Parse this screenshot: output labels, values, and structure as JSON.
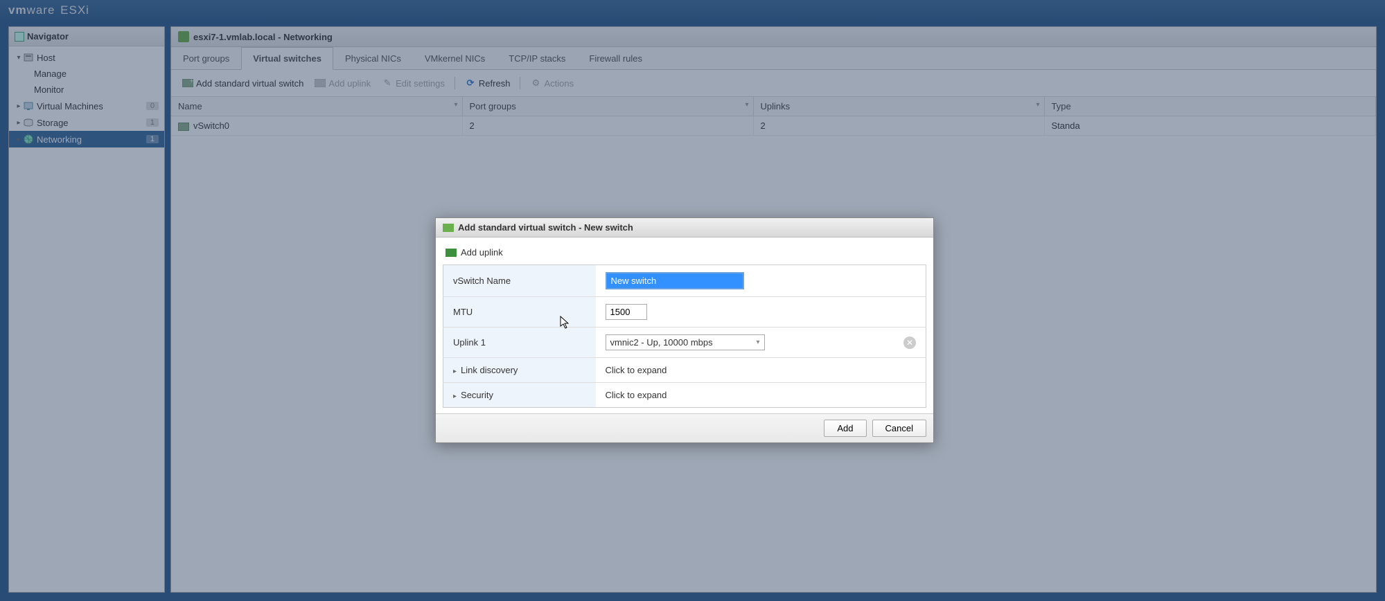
{
  "header": {
    "brand_vm": "vm",
    "brand_ware": "ware",
    "brand_esxi": " ESXi"
  },
  "sidebar": {
    "title": "Navigator",
    "header_badge": "",
    "host": {
      "label": "Host",
      "manage": "Manage",
      "monitor": "Monitor"
    },
    "vms": {
      "label": "Virtual Machines",
      "count": "0"
    },
    "storage": {
      "label": "Storage",
      "count": "1"
    },
    "networking": {
      "label": "Networking",
      "count": "1"
    }
  },
  "content": {
    "breadcrumb": "esxi7-1.vmlab.local - Networking",
    "tabs": {
      "port_groups": "Port groups",
      "virtual_switches": "Virtual switches",
      "physical_nics": "Physical NICs",
      "vmkernel_nics": "VMkernel NICs",
      "tcpip_stacks": "TCP/IP stacks",
      "firewall_rules": "Firewall rules"
    },
    "toolbar": {
      "add_switch": "Add standard virtual switch",
      "add_uplink": "Add uplink",
      "edit_settings": "Edit settings",
      "refresh": "Refresh",
      "actions": "Actions"
    },
    "grid": {
      "cols": {
        "name": "Name",
        "port_groups": "Port groups",
        "uplinks": "Uplinks",
        "type": "Type"
      },
      "rows": [
        {
          "name": "vSwitch0",
          "port_groups": "2",
          "uplinks": "2",
          "type": "Standa"
        }
      ]
    }
  },
  "dialog": {
    "title": "Add standard virtual switch - New switch",
    "add_uplink": "Add uplink",
    "rows": {
      "name_label": "vSwitch Name",
      "name_value": "New switch",
      "mtu_label": "MTU",
      "mtu_value": "1500",
      "uplink1_label": "Uplink 1",
      "uplink1_value": "vmnic2 - Up, 10000 mbps",
      "link_discovery_label": "Link discovery",
      "link_discovery_value": "Click to expand",
      "security_label": "Security",
      "security_value": "Click to expand"
    },
    "buttons": {
      "add": "Add",
      "cancel": "Cancel"
    }
  }
}
